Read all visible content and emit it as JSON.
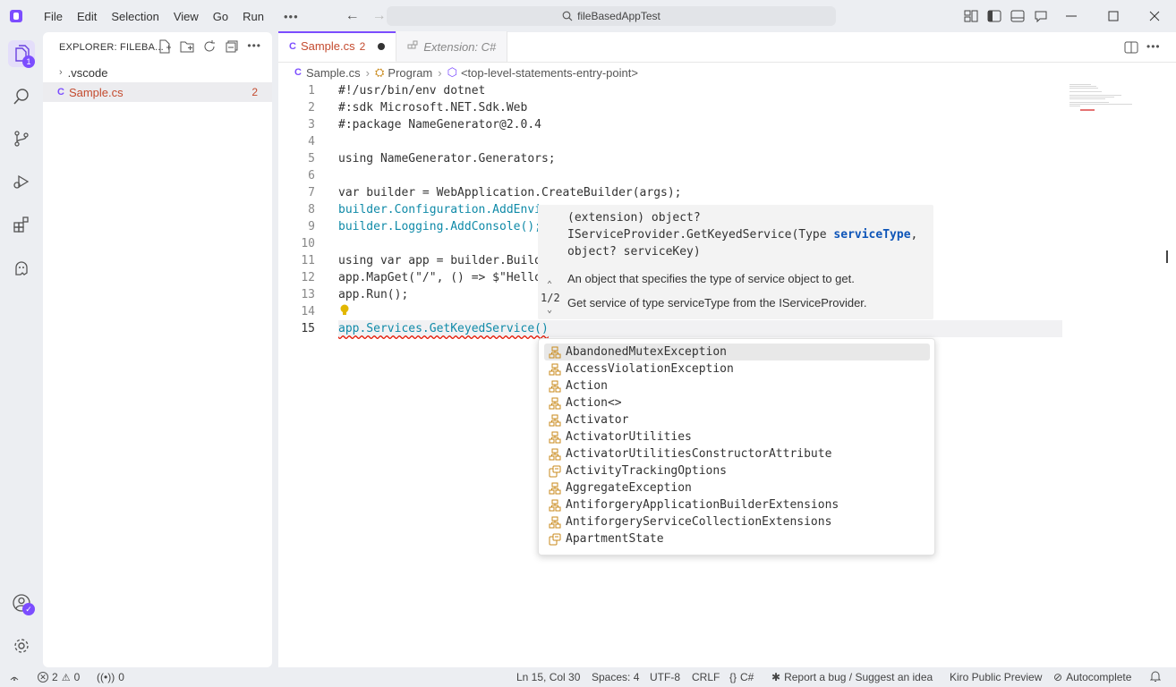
{
  "titlebar": {
    "menu": [
      "File",
      "Edit",
      "Selection",
      "View",
      "Go",
      "Run"
    ],
    "more": "•••",
    "search_text": "fileBasedAppTest"
  },
  "activity": {
    "explorer_badge": "1"
  },
  "sidebar": {
    "title": "EXPLORER: FILEBA...",
    "tree": [
      {
        "label": ".vscode",
        "kind": "folder"
      },
      {
        "label": "Sample.cs",
        "kind": "file",
        "problems": "2"
      }
    ]
  },
  "editor": {
    "tabs": [
      {
        "label": "Sample.cs",
        "problems": "2",
        "modified": true
      },
      {
        "label": "Extension: C#"
      }
    ],
    "breadcrumb": [
      "Sample.cs",
      "Program",
      "<top-level-statements-entry-point>"
    ],
    "lines": [
      {
        "n": "1",
        "text": "#!/usr/bin/env dotnet"
      },
      {
        "n": "2",
        "text": "#:sdk Microsoft.NET.Sdk.Web"
      },
      {
        "n": "3",
        "text": "#:package NameGenerator@2.0.4"
      },
      {
        "n": "4",
        "text": ""
      },
      {
        "n": "5",
        "text": "using NameGenerator.Generators;"
      },
      {
        "n": "6",
        "text": ""
      },
      {
        "n": "7",
        "text": "var builder = WebApplication.CreateBuilder(args);"
      },
      {
        "n": "8",
        "text": "builder.Configuration.AddEnvi"
      },
      {
        "n": "9",
        "text": "builder.Logging.AddConsole();"
      },
      {
        "n": "10",
        "text": ""
      },
      {
        "n": "11",
        "text": "using var app = builder.Build"
      },
      {
        "n": "12",
        "text": "app.MapGet(\"/\", () => $\"Hello"
      },
      {
        "n": "13",
        "text": "app.Run();"
      },
      {
        "n": "14",
        "text": ""
      },
      {
        "n": "15",
        "text": "app.Services.GetKeyedService()"
      }
    ]
  },
  "signature_help": {
    "sig_prefix": "(extension) object?\nIServiceProvider.GetKeyedService(Type ",
    "active_param": "serviceType",
    "sig_suffix": ",\nobject? serviceKey)",
    "param_doc": "An object that specifies the type of service object to get.",
    "method_doc": "Get service of type serviceType from the IServiceProvider.",
    "overload": "1/2"
  },
  "suggestions": [
    {
      "label": "AbandonedMutexException",
      "icon": "class-icon"
    },
    {
      "label": "AccessViolationException",
      "icon": "class-icon"
    },
    {
      "label": "Action",
      "icon": "class-icon"
    },
    {
      "label": "Action<>",
      "icon": "class-icon"
    },
    {
      "label": "Activator",
      "icon": "class-icon"
    },
    {
      "label": "ActivatorUtilities",
      "icon": "class-icon"
    },
    {
      "label": "ActivatorUtilitiesConstructorAttribute",
      "icon": "class-icon"
    },
    {
      "label": "ActivityTrackingOptions",
      "icon": "enum-icon"
    },
    {
      "label": "AggregateException",
      "icon": "class-icon"
    },
    {
      "label": "AntiforgeryApplicationBuilderExtensions",
      "icon": "class-icon"
    },
    {
      "label": "AntiforgeryServiceCollectionExtensions",
      "icon": "class-icon"
    },
    {
      "label": "ApartmentState",
      "icon": "enum-icon"
    }
  ],
  "status": {
    "errors": "2",
    "warnings": "0",
    "ports": "0",
    "position": "Ln 15, Col 30",
    "spaces": "Spaces: 4",
    "encoding": "UTF-8",
    "eol": "CRLF",
    "language": "C#",
    "report": "Report a bug / Suggest an idea",
    "preview": "Kiro Public Preview",
    "autocomplete": "Autocomplete"
  },
  "colors": {
    "accent": "#7c4dff",
    "error": "#e51400",
    "modified_file": "#c44b2f",
    "symbol_class": "#c98a1b"
  }
}
